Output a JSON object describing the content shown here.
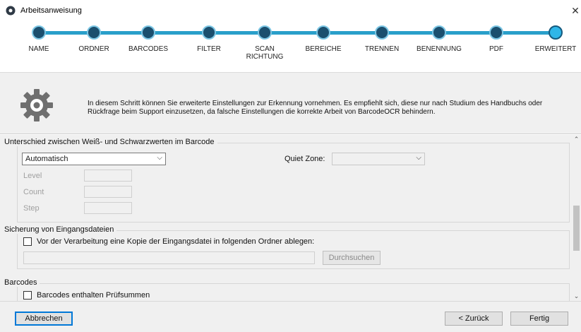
{
  "window": {
    "title": "Arbeitsanweisung",
    "close_glyph": "✕"
  },
  "steps": [
    {
      "label": "NAME",
      "state": "done"
    },
    {
      "label": "ORDNER",
      "state": "done"
    },
    {
      "label": "BARCODES",
      "state": "done"
    },
    {
      "label": "FILTER",
      "state": "done"
    },
    {
      "label": "SCAN\nRICHTUNG",
      "state": "done"
    },
    {
      "label": "BEREICHE",
      "state": "done"
    },
    {
      "label": "TRENNEN",
      "state": "done"
    },
    {
      "label": "BENENNUNG",
      "state": "done"
    },
    {
      "label": "PDF",
      "state": "done"
    },
    {
      "label": "ERWEITERT",
      "state": "current"
    }
  ],
  "header": {
    "icon": "gear-icon",
    "text": "In diesem Schritt können Sie erweiterte Einstellungen zur Erkennung vornehmen. Es empfiehlt sich, diese nur nach Studium des Handbuchs oder Rückfrage beim Support einzusetzen, da falsche Einstellungen die korrekte Arbeit von BarcodeOCR behindern."
  },
  "contrast_group": {
    "title": "Unterschied zwischen Weiß- und Schwarzwerten im Barcode",
    "mode_value": "Automatisch",
    "quiet_zone_label": "Quiet Zone:",
    "quiet_zone_value": "",
    "level_label": "Level",
    "count_label": "Count",
    "step_label": "Step"
  },
  "backup_group": {
    "title": "Sicherung von Eingangsdateien",
    "checkbox_label": "Vor der Verarbeitung eine Kopie der Eingangsdatei in folgenden Ordner ablegen:",
    "path_value": "",
    "browse_label": "Durchsuchen"
  },
  "barcodes_group": {
    "title": "Barcodes",
    "checksum_label": "Barcodes enthalten Prüfsummen"
  },
  "footer": {
    "cancel_label": "Abbrechen",
    "back_label": "< Zurück",
    "finish_label": "Fertig"
  },
  "colors": {
    "step_line": "#2a9fca",
    "step_dot": "#1b4f6e",
    "step_current": "#2fb6e8",
    "focus_border": "#0078d7"
  }
}
